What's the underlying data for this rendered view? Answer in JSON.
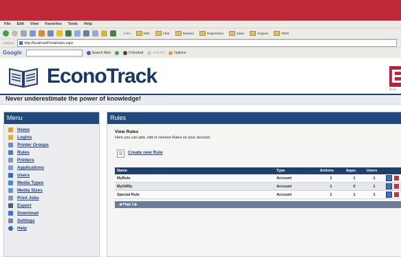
{
  "browser": {
    "menus": [
      "File",
      "Edit",
      "View",
      "Favorites",
      "Tools",
      "Help"
    ],
    "links_label": "Links",
    "links": [
      "Web",
      "CMS",
      "Delivery",
      "Registration",
      "Sales",
      "Support",
      "WMS"
    ],
    "address_label": "Address",
    "address": "http://localhost/Portal/rules.aspx",
    "google_label": "Google",
    "search_web": "Search Web",
    "blocked": "0 blocked",
    "autofill": "AutoFill",
    "options": "Options"
  },
  "app": {
    "name_prefix": "Econo",
    "name_suffix": "Track",
    "tagline": "Never underestimate the power of knowledge!",
    "brand_letter": "E",
    "brand_sub": "Econ"
  },
  "menu": {
    "title": "Menu",
    "items": [
      {
        "label": "Home",
        "icon": "home-icon",
        "color": "#e0a030"
      },
      {
        "label": "Logins",
        "icon": "key-icon",
        "color": "#d9b23a"
      },
      {
        "label": "Printer Groups",
        "icon": "printer-group-icon",
        "color": "#6a8fc4"
      },
      {
        "label": "Rules",
        "icon": "rules-icon",
        "color": "#4d7ec2"
      },
      {
        "label": "Printers",
        "icon": "printer-icon",
        "color": "#8899aa"
      },
      {
        "label": "Applications",
        "icon": "applications-icon",
        "color": "#7aa0d0"
      },
      {
        "label": "Users",
        "icon": "users-icon",
        "color": "#3a6fb6"
      },
      {
        "label": "Media Types",
        "icon": "media-types-icon",
        "color": "#4b89c8"
      },
      {
        "label": "Media Sizes",
        "icon": "media-sizes-icon",
        "color": "#5e97cf"
      },
      {
        "label": "Print Jobs",
        "icon": "print-jobs-icon",
        "color": "#8a9bb0"
      },
      {
        "label": "Export",
        "icon": "export-icon",
        "color": "#555e6c"
      },
      {
        "label": "Download",
        "icon": "download-icon",
        "color": "#3c7bd1"
      },
      {
        "label": "Settings",
        "icon": "settings-icon",
        "color": "#7c8896"
      },
      {
        "label": "Help",
        "icon": "help-icon",
        "color": "#2f6ec9"
      }
    ]
  },
  "rules": {
    "title": "Rules",
    "heading": "View Rules",
    "description": "Here you can add, edit or remove Rules on your account.",
    "create_label": "Create new Rule",
    "columns": [
      "Name",
      "Type",
      "Actions",
      "Apps.",
      "Users"
    ],
    "rows": [
      {
        "name": "MyRule",
        "type": "Account",
        "actions": "1",
        "apps": "1",
        "users": "1"
      },
      {
        "name": "MyOtRly",
        "type": "Account",
        "actions": "1",
        "apps": "0",
        "users": "1"
      },
      {
        "name": "Special Rule",
        "type": "Account",
        "actions": "1",
        "apps": "1",
        "users": "1"
      }
    ],
    "pager": "◀ Page 1 ▶"
  }
}
